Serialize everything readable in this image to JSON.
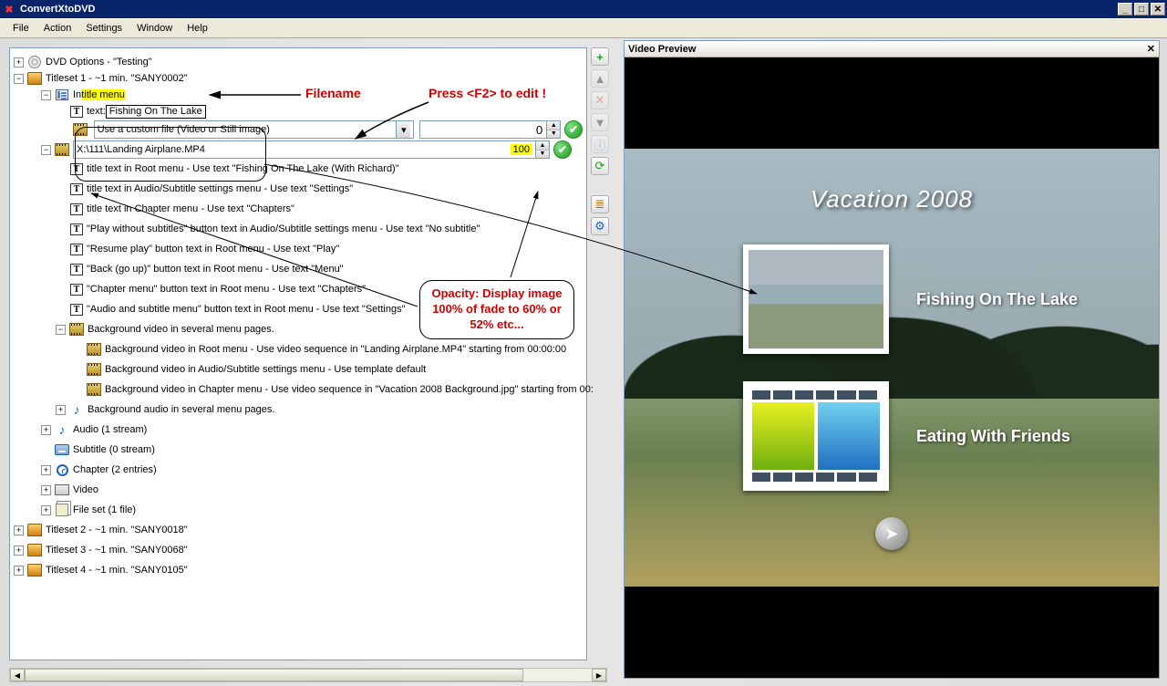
{
  "window": {
    "title": "ConvertXtoDVD"
  },
  "menu": {
    "file": "File",
    "action": "Action",
    "settings": "Settings",
    "window": "Window",
    "help": "Help"
  },
  "tree": {
    "dvd_options": "DVD Options - \"Testing\"",
    "titleset1": "Titleset 1 - ~1 min. \"SANY0002\"",
    "in_title_menu_prefix": "In ",
    "in_title_menu_hl": "title menu",
    "text_label": "text:",
    "text_value": "Fishing On The Lake",
    "combo_value": "Use a custom file (Video or Still image)",
    "numfield1": "0",
    "path_value": "X:\\111\\Landing Airplane.MP4",
    "numfield2": "100",
    "lines": {
      "l1": "title text in Root menu - Use text \"Fishing On The Lake  (With Richard)\"",
      "l2": "title text in Audio/Subtitle settings menu - Use text \"Settings\"",
      "l3": "title text in Chapter menu - Use text \"Chapters\"",
      "l4": "\"Play without subtitles\" button text in Audio/Subtitle settings menu - Use text \"No subtitle\"",
      "l5": "\"Resume play\" button text in Root menu - Use text \"Play\"",
      "l6": "\"Back (go up)\" button text in Root menu - Use text \"Menu\"",
      "l7": "\"Chapter menu\" button text in Root menu - Use text \"Chapters\"",
      "l8": "\"Audio and subtitle menu\" button text in Root menu - Use text \"Settings\""
    },
    "bg_group": "Background video in several menu pages.",
    "bg1": "Background video in Root menu - Use video sequence in \"Landing Airplane.MP4\" starting from 00:00:00",
    "bg2": "Background video in Audio/Subtitle settings menu - Use template default",
    "bg3": "Background video in Chapter menu - Use video sequence in \"Vacation 2008 Background.jpg\" starting from 00:",
    "bga": "Background audio in several menu pages.",
    "audio": "Audio (1 stream)",
    "subtitle": "Subtitle (0 stream)",
    "chapter": "Chapter (2 entries)",
    "video": "Video",
    "fileset": "File set (1 file)",
    "titleset2": "Titleset 2 - ~1 min. \"SANY0018\"",
    "titleset3": "Titleset 3 - ~1 min. \"SANY0068\"",
    "titleset4": "Titleset 4 - ~1 min. \"SANY0105\""
  },
  "preview": {
    "header": "Video Preview",
    "menu_title": "Vacation 2008",
    "item1": "Fishing On The Lake",
    "item2": "Eating With Friends"
  },
  "annot": {
    "filename": "Filename",
    "f2": "Press <F2> to edit !",
    "opacity": "Opacity: Display image 100% of fade to 60% or 52% etc..."
  },
  "toolbar": {
    "add": "+",
    "up": "▲",
    "del": "✕",
    "down": "▼",
    "info": "ⓘ",
    "refresh": "⟳",
    "org": "≣",
    "opts": "⚙"
  }
}
